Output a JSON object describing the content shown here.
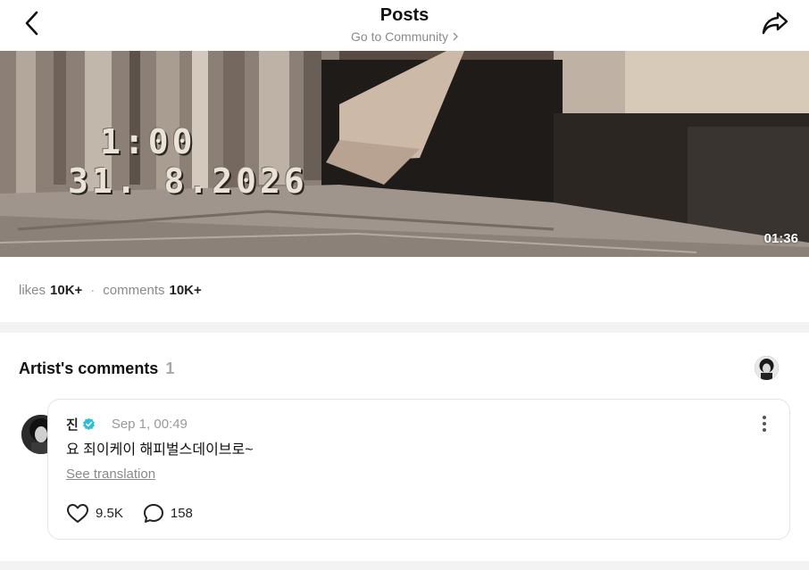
{
  "header": {
    "title": "Posts",
    "subtitle": "Go to Community",
    "back_icon": "chevron-left-icon",
    "share_icon": "share-arrow-icon"
  },
  "video": {
    "stamp_time": "1:00",
    "stamp_date": "31. 8.2026",
    "duration": "01:36"
  },
  "stats": {
    "likes_label": "likes",
    "likes_value": "10K+",
    "separator": "·",
    "comments_label": "comments",
    "comments_value": "10K+"
  },
  "artist_comments": {
    "title": "Artist's comments",
    "count": "1",
    "comments": [
      {
        "author": "진",
        "verified": true,
        "time": "Sep 1, 00:49",
        "text": "요 죄이케이 해피벌스데이브로~",
        "translate_label": "See translation",
        "likes": "9.5K",
        "replies": "158"
      }
    ]
  },
  "colors": {
    "verified_badge": "#27c0d6",
    "muted_text": "#8a8a8a",
    "divider": "#f3f3f3"
  }
}
